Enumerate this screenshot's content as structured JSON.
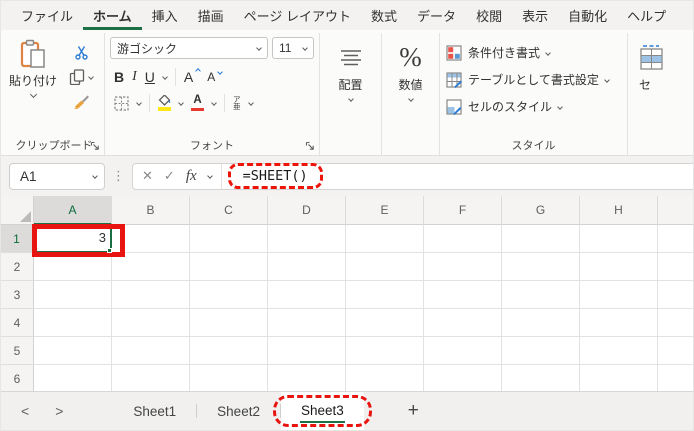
{
  "menu": {
    "tabs": [
      "ファイル",
      "ホーム",
      "挿入",
      "描画",
      "ページ レイアウト",
      "数式",
      "データ",
      "校閲",
      "表示",
      "自動化",
      "ヘルプ"
    ]
  },
  "ribbon": {
    "clipboard": {
      "paste": "貼り付け",
      "group": "クリップボード"
    },
    "font": {
      "name": "游ゴシック",
      "size": "11",
      "bold": "B",
      "italic": "I",
      "underline": "U",
      "grow_letter": "A",
      "shrink_letter": "A",
      "font_color_letter": "A",
      "phonetic_top": "ア",
      "phonetic_bottom": "亜",
      "group": "フォント"
    },
    "alignment": {
      "label": "配置"
    },
    "number": {
      "label": "数値",
      "percent": "%"
    },
    "styles": {
      "conditional": "条件付き書式",
      "format_table": "テーブルとして書式設定",
      "cell_styles": "セルのスタイル",
      "group": "スタイル"
    },
    "cells": {
      "partial_label": "セ"
    }
  },
  "formula_bar": {
    "name_box": "A1",
    "cancel": "✕",
    "enter": "✓",
    "fx": "fx",
    "formula": "=SHEET()"
  },
  "grid": {
    "columns": [
      "A",
      "B",
      "C",
      "D",
      "E",
      "F",
      "G",
      "H"
    ],
    "rows": [
      "1",
      "2",
      "3",
      "4",
      "5",
      "6"
    ],
    "active_cell": "A1",
    "a1_value": "3"
  },
  "sheet_bar": {
    "prev": "<",
    "next": ">",
    "tabs": [
      "Sheet1",
      "Sheet2",
      "Sheet3"
    ],
    "active_tab": "Sheet3",
    "add": "+"
  },
  "colors": {
    "excel_green": "#1d7044",
    "annotation_red": "#e8140f",
    "accent_blue": "#2b7cd3",
    "highlight_yellow": "#ffe81a",
    "font_color_red": "#e8392f"
  }
}
